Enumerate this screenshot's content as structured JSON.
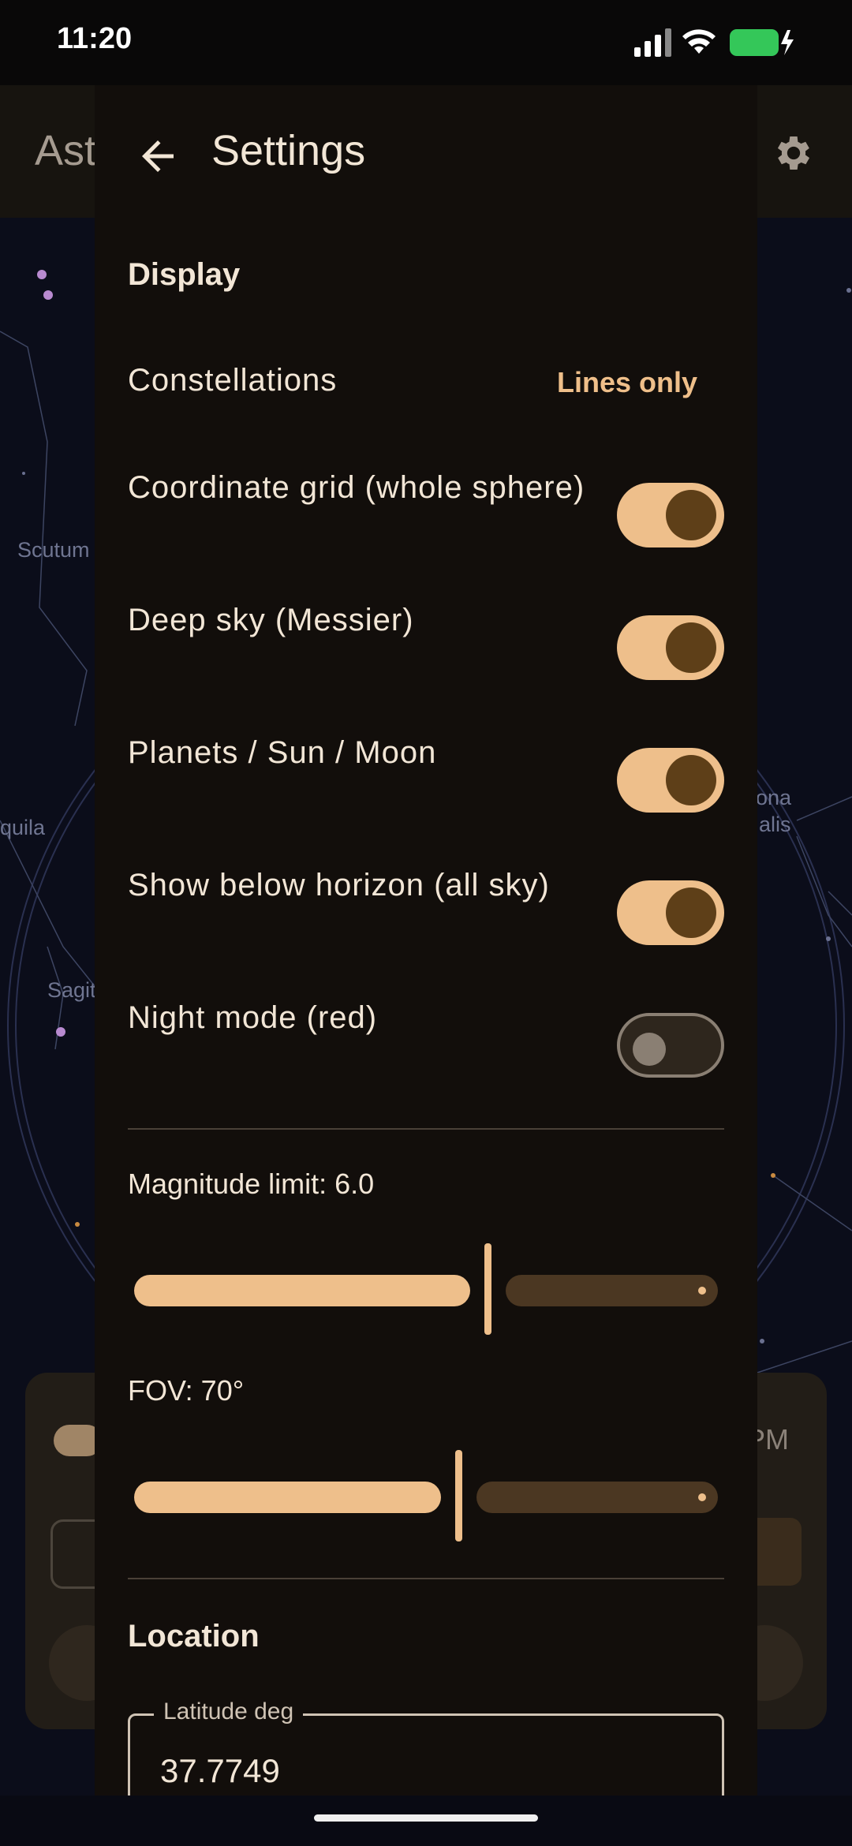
{
  "status_bar": {
    "time": "11:20"
  },
  "background": {
    "app_title": "Ast",
    "constellations": [
      "Scutum",
      "quila",
      "Sagit",
      "ona",
      "alis"
    ],
    "panel_time_suffix": "PM"
  },
  "sheet": {
    "title": "Settings",
    "display_section": "Display",
    "constellations": {
      "label": "Constellations",
      "value": "Lines only"
    },
    "toggles": [
      {
        "label": "Coordinate grid (whole sphere)",
        "on": true
      },
      {
        "label": "Deep sky (Messier)",
        "on": true
      },
      {
        "label": "Planets / Sun / Moon",
        "on": true
      },
      {
        "label": "Show below horizon (all sky)",
        "on": true
      },
      {
        "label": "Night mode (red)",
        "on": false
      }
    ],
    "magnitude": {
      "label": "Magnitude limit: 6.0",
      "fraction": 0.6
    },
    "fov": {
      "label": "FOV: 70°",
      "fraction": 0.55
    },
    "location_section": "Location",
    "latitude": {
      "legend": "Latitude deg",
      "value": "37.7749"
    }
  },
  "colors": {
    "accent": "#eebf8b",
    "knob_on": "#5e3f18",
    "sheet_bg": "#120e0b",
    "sky_bg": "#0b0d1a"
  }
}
